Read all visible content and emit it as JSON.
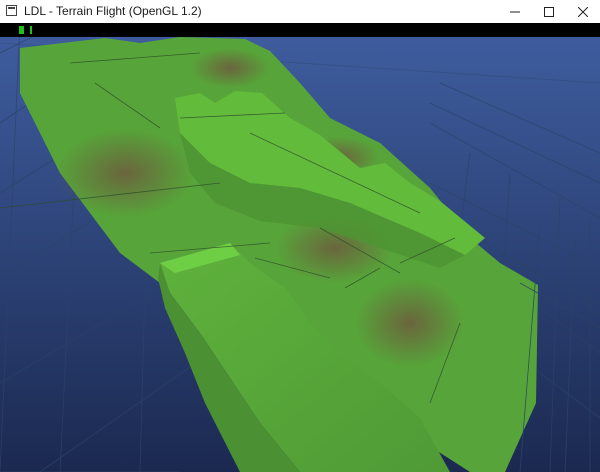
{
  "window": {
    "title": "LDL - Terrain Flight (OpenGL 1.2)",
    "app_icon": "window-app-icon",
    "controls": [
      "minimize-icon",
      "maximize-icon",
      "close-icon"
    ]
  },
  "hud": {
    "indicators": [
      {
        "name": "hud-bar-1",
        "color": "#19c319"
      },
      {
        "name": "hud-bar-2",
        "color": "#19c319"
      }
    ]
  },
  "scene": {
    "sky_top": "#3d5a9b",
    "sky_bottom": "#1c2a50",
    "terrain_color": "#58a83a",
    "terrain_light": "#62c23a",
    "terrain_dirt": "#6b5a3a",
    "grid_color": "#233a55"
  }
}
